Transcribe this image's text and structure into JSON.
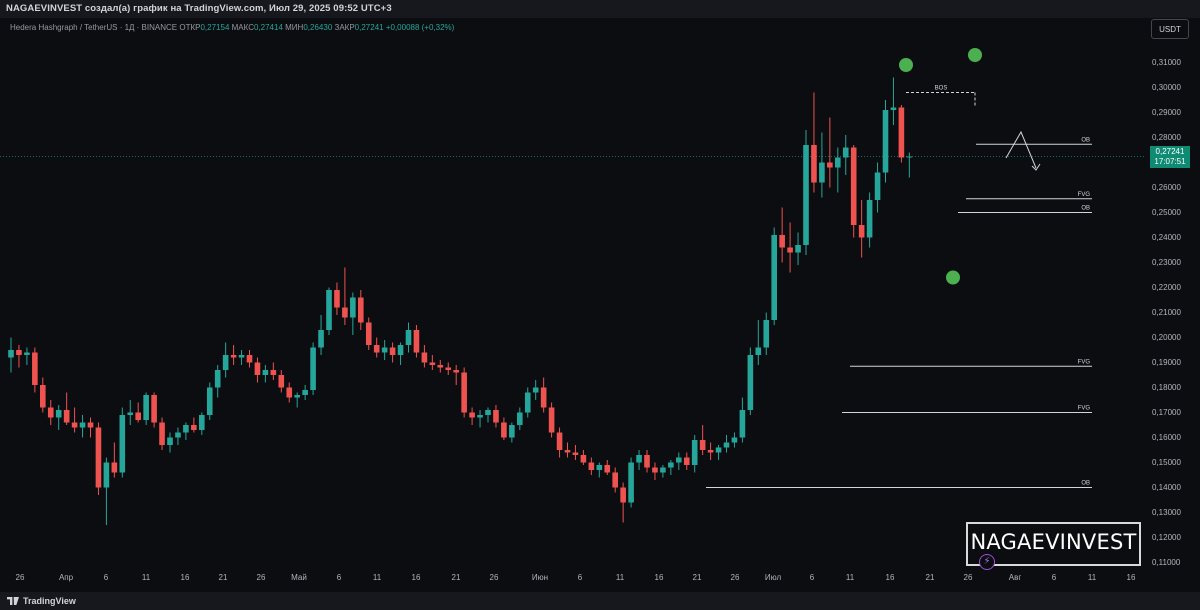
{
  "header": {
    "attribution": "NAGAEVINVEST создал(а) график на TradingView.com, Июл 29, 2025 09:52 UTC+3"
  },
  "symbol": {
    "name": "Hedera Hashgraph / TetherUS · 1Д · BINANCE",
    "open_label": "ОТКР",
    "open": "0,27154",
    "high_label": "МАКС",
    "high": "0,27414",
    "low_label": "МИН",
    "low": "0,26430",
    "close_label": "ЗАКР",
    "close": "0,27241",
    "change": "+0,00088 (+0,32%)"
  },
  "currency_button": "USDT",
  "current_price": {
    "value": "0,27241",
    "countdown": "17:07:51"
  },
  "footer": {
    "logo_text": "TradingView"
  },
  "brand": {
    "text": "NAGAEVINVEST",
    "badge_icon": "lightning-icon"
  },
  "colors": {
    "up": "#26a69a",
    "down": "#ef5350",
    "background": "#0c0d10",
    "marker": "#4caf50",
    "annotation": "#d1d4dc"
  },
  "chart_data": {
    "type": "candlestick",
    "title": "Hedera Hashgraph / TetherUS · 1Д · BINANCE",
    "price_ticks": [
      "0,31000",
      "0,30000",
      "0,29000",
      "0,28000",
      "0,26000",
      "0,25000",
      "0,24000",
      "0,23000",
      "0,22000",
      "0,21000",
      "0,20000",
      "0,19000",
      "0,18000",
      "0,17000",
      "0,16000",
      "0,15000",
      "0,14000",
      "0,13000",
      "0,12000",
      "0,11000"
    ],
    "date_ticks": [
      "26",
      "Апр",
      "6",
      "11",
      "16",
      "21",
      "26",
      "Май",
      "6",
      "11",
      "16",
      "21",
      "26",
      "Июн",
      "6",
      "11",
      "16",
      "21",
      "26",
      "Июл",
      "6",
      "11",
      "16",
      "21",
      "26",
      "Авг",
      "6",
      "11",
      "16"
    ],
    "ylim": [
      0.105,
      0.32
    ],
    "grid": false,
    "last_price": 0.27241,
    "candles": [
      {
        "o": 0.192,
        "h": 0.2,
        "l": 0.186,
        "c": 0.195
      },
      {
        "o": 0.195,
        "h": 0.197,
        "l": 0.188,
        "c": 0.193
      },
      {
        "o": 0.193,
        "h": 0.196,
        "l": 0.189,
        "c": 0.194
      },
      {
        "o": 0.194,
        "h": 0.196,
        "l": 0.178,
        "c": 0.181
      },
      {
        "o": 0.181,
        "h": 0.184,
        "l": 0.17,
        "c": 0.172
      },
      {
        "o": 0.172,
        "h": 0.175,
        "l": 0.165,
        "c": 0.168
      },
      {
        "o": 0.168,
        "h": 0.173,
        "l": 0.163,
        "c": 0.171
      },
      {
        "o": 0.171,
        "h": 0.178,
        "l": 0.165,
        "c": 0.166
      },
      {
        "o": 0.166,
        "h": 0.172,
        "l": 0.162,
        "c": 0.164
      },
      {
        "o": 0.164,
        "h": 0.169,
        "l": 0.16,
        "c": 0.166
      },
      {
        "o": 0.166,
        "h": 0.168,
        "l": 0.16,
        "c": 0.164
      },
      {
        "o": 0.164,
        "h": 0.166,
        "l": 0.137,
        "c": 0.14
      },
      {
        "o": 0.14,
        "h": 0.152,
        "l": 0.125,
        "c": 0.15
      },
      {
        "o": 0.15,
        "h": 0.158,
        "l": 0.144,
        "c": 0.146
      },
      {
        "o": 0.146,
        "h": 0.172,
        "l": 0.144,
        "c": 0.169
      },
      {
        "o": 0.169,
        "h": 0.175,
        "l": 0.165,
        "c": 0.17
      },
      {
        "o": 0.17,
        "h": 0.174,
        "l": 0.166,
        "c": 0.167
      },
      {
        "o": 0.167,
        "h": 0.178,
        "l": 0.165,
        "c": 0.177
      },
      {
        "o": 0.177,
        "h": 0.178,
        "l": 0.164,
        "c": 0.166
      },
      {
        "o": 0.166,
        "h": 0.168,
        "l": 0.155,
        "c": 0.157
      },
      {
        "o": 0.157,
        "h": 0.162,
        "l": 0.154,
        "c": 0.16
      },
      {
        "o": 0.16,
        "h": 0.164,
        "l": 0.157,
        "c": 0.162
      },
      {
        "o": 0.162,
        "h": 0.166,
        "l": 0.159,
        "c": 0.165
      },
      {
        "o": 0.165,
        "h": 0.168,
        "l": 0.162,
        "c": 0.163
      },
      {
        "o": 0.163,
        "h": 0.17,
        "l": 0.161,
        "c": 0.169
      },
      {
        "o": 0.169,
        "h": 0.182,
        "l": 0.167,
        "c": 0.18
      },
      {
        "o": 0.18,
        "h": 0.189,
        "l": 0.176,
        "c": 0.187
      },
      {
        "o": 0.187,
        "h": 0.198,
        "l": 0.184,
        "c": 0.193
      },
      {
        "o": 0.193,
        "h": 0.197,
        "l": 0.189,
        "c": 0.192
      },
      {
        "o": 0.192,
        "h": 0.195,
        "l": 0.189,
        "c": 0.193
      },
      {
        "o": 0.193,
        "h": 0.195,
        "l": 0.188,
        "c": 0.19
      },
      {
        "o": 0.19,
        "h": 0.192,
        "l": 0.182,
        "c": 0.185
      },
      {
        "o": 0.185,
        "h": 0.189,
        "l": 0.182,
        "c": 0.187
      },
      {
        "o": 0.187,
        "h": 0.19,
        "l": 0.183,
        "c": 0.185
      },
      {
        "o": 0.185,
        "h": 0.187,
        "l": 0.178,
        "c": 0.18
      },
      {
        "o": 0.18,
        "h": 0.182,
        "l": 0.174,
        "c": 0.176
      },
      {
        "o": 0.176,
        "h": 0.178,
        "l": 0.172,
        "c": 0.177
      },
      {
        "o": 0.177,
        "h": 0.181,
        "l": 0.175,
        "c": 0.179
      },
      {
        "o": 0.179,
        "h": 0.198,
        "l": 0.177,
        "c": 0.196
      },
      {
        "o": 0.196,
        "h": 0.209,
        "l": 0.193,
        "c": 0.203
      },
      {
        "o": 0.203,
        "h": 0.22,
        "l": 0.201,
        "c": 0.219
      },
      {
        "o": 0.219,
        "h": 0.222,
        "l": 0.209,
        "c": 0.212
      },
      {
        "o": 0.212,
        "h": 0.228,
        "l": 0.205,
        "c": 0.208
      },
      {
        "o": 0.208,
        "h": 0.218,
        "l": 0.201,
        "c": 0.216
      },
      {
        "o": 0.216,
        "h": 0.219,
        "l": 0.203,
        "c": 0.206
      },
      {
        "o": 0.206,
        "h": 0.208,
        "l": 0.195,
        "c": 0.197
      },
      {
        "o": 0.197,
        "h": 0.2,
        "l": 0.192,
        "c": 0.194
      },
      {
        "o": 0.194,
        "h": 0.199,
        "l": 0.191,
        "c": 0.196
      },
      {
        "o": 0.196,
        "h": 0.198,
        "l": 0.19,
        "c": 0.193
      },
      {
        "o": 0.193,
        "h": 0.198,
        "l": 0.189,
        "c": 0.197
      },
      {
        "o": 0.197,
        "h": 0.206,
        "l": 0.194,
        "c": 0.203
      },
      {
        "o": 0.203,
        "h": 0.205,
        "l": 0.192,
        "c": 0.194
      },
      {
        "o": 0.194,
        "h": 0.197,
        "l": 0.188,
        "c": 0.19
      },
      {
        "o": 0.19,
        "h": 0.193,
        "l": 0.187,
        "c": 0.189
      },
      {
        "o": 0.189,
        "h": 0.191,
        "l": 0.186,
        "c": 0.188
      },
      {
        "o": 0.188,
        "h": 0.19,
        "l": 0.185,
        "c": 0.187
      },
      {
        "o": 0.187,
        "h": 0.189,
        "l": 0.181,
        "c": 0.186
      },
      {
        "o": 0.186,
        "h": 0.188,
        "l": 0.168,
        "c": 0.17
      },
      {
        "o": 0.17,
        "h": 0.172,
        "l": 0.165,
        "c": 0.168
      },
      {
        "o": 0.168,
        "h": 0.171,
        "l": 0.164,
        "c": 0.169
      },
      {
        "o": 0.169,
        "h": 0.172,
        "l": 0.166,
        "c": 0.171
      },
      {
        "o": 0.171,
        "h": 0.173,
        "l": 0.164,
        "c": 0.166
      },
      {
        "o": 0.166,
        "h": 0.168,
        "l": 0.159,
        "c": 0.16
      },
      {
        "o": 0.16,
        "h": 0.166,
        "l": 0.158,
        "c": 0.165
      },
      {
        "o": 0.165,
        "h": 0.172,
        "l": 0.163,
        "c": 0.17
      },
      {
        "o": 0.17,
        "h": 0.18,
        "l": 0.168,
        "c": 0.178
      },
      {
        "o": 0.178,
        "h": 0.183,
        "l": 0.175,
        "c": 0.18
      },
      {
        "o": 0.18,
        "h": 0.184,
        "l": 0.17,
        "c": 0.172
      },
      {
        "o": 0.172,
        "h": 0.174,
        "l": 0.16,
        "c": 0.162
      },
      {
        "o": 0.162,
        "h": 0.164,
        "l": 0.152,
        "c": 0.155
      },
      {
        "o": 0.155,
        "h": 0.158,
        "l": 0.152,
        "c": 0.154
      },
      {
        "o": 0.154,
        "h": 0.157,
        "l": 0.151,
        "c": 0.153
      },
      {
        "o": 0.153,
        "h": 0.155,
        "l": 0.149,
        "c": 0.15
      },
      {
        "o": 0.15,
        "h": 0.152,
        "l": 0.145,
        "c": 0.147
      },
      {
        "o": 0.147,
        "h": 0.15,
        "l": 0.144,
        "c": 0.149
      },
      {
        "o": 0.149,
        "h": 0.151,
        "l": 0.145,
        "c": 0.146
      },
      {
        "o": 0.146,
        "h": 0.148,
        "l": 0.138,
        "c": 0.14
      },
      {
        "o": 0.14,
        "h": 0.142,
        "l": 0.126,
        "c": 0.134
      },
      {
        "o": 0.134,
        "h": 0.152,
        "l": 0.132,
        "c": 0.15
      },
      {
        "o": 0.15,
        "h": 0.155,
        "l": 0.147,
        "c": 0.153
      },
      {
        "o": 0.153,
        "h": 0.155,
        "l": 0.146,
        "c": 0.148
      },
      {
        "o": 0.148,
        "h": 0.15,
        "l": 0.143,
        "c": 0.146
      },
      {
        "o": 0.146,
        "h": 0.149,
        "l": 0.144,
        "c": 0.148
      },
      {
        "o": 0.148,
        "h": 0.151,
        "l": 0.145,
        "c": 0.15
      },
      {
        "o": 0.15,
        "h": 0.154,
        "l": 0.147,
        "c": 0.152
      },
      {
        "o": 0.152,
        "h": 0.154,
        "l": 0.147,
        "c": 0.149
      },
      {
        "o": 0.149,
        "h": 0.161,
        "l": 0.146,
        "c": 0.159
      },
      {
        "o": 0.159,
        "h": 0.165,
        "l": 0.153,
        "c": 0.155
      },
      {
        "o": 0.155,
        "h": 0.158,
        "l": 0.151,
        "c": 0.154
      },
      {
        "o": 0.154,
        "h": 0.157,
        "l": 0.151,
        "c": 0.156
      },
      {
        "o": 0.156,
        "h": 0.161,
        "l": 0.154,
        "c": 0.158
      },
      {
        "o": 0.158,
        "h": 0.162,
        "l": 0.156,
        "c": 0.16
      },
      {
        "o": 0.16,
        "h": 0.176,
        "l": 0.158,
        "c": 0.171
      },
      {
        "o": 0.171,
        "h": 0.196,
        "l": 0.169,
        "c": 0.193
      },
      {
        "o": 0.193,
        "h": 0.207,
        "l": 0.189,
        "c": 0.196
      },
      {
        "o": 0.196,
        "h": 0.21,
        "l": 0.193,
        "c": 0.207
      },
      {
        "o": 0.207,
        "h": 0.244,
        "l": 0.205,
        "c": 0.241
      },
      {
        "o": 0.241,
        "h": 0.252,
        "l": 0.23,
        "c": 0.236
      },
      {
        "o": 0.236,
        "h": 0.246,
        "l": 0.226,
        "c": 0.234
      },
      {
        "o": 0.234,
        "h": 0.242,
        "l": 0.229,
        "c": 0.237
      },
      {
        "o": 0.237,
        "h": 0.283,
        "l": 0.233,
        "c": 0.277
      },
      {
        "o": 0.277,
        "h": 0.298,
        "l": 0.258,
        "c": 0.262
      },
      {
        "o": 0.262,
        "h": 0.282,
        "l": 0.256,
        "c": 0.27
      },
      {
        "o": 0.27,
        "h": 0.288,
        "l": 0.26,
        "c": 0.268
      },
      {
        "o": 0.268,
        "h": 0.276,
        "l": 0.258,
        "c": 0.272
      },
      {
        "o": 0.272,
        "h": 0.281,
        "l": 0.265,
        "c": 0.276
      },
      {
        "o": 0.276,
        "h": 0.277,
        "l": 0.24,
        "c": 0.245
      },
      {
        "o": 0.245,
        "h": 0.255,
        "l": 0.232,
        "c": 0.24
      },
      {
        "o": 0.24,
        "h": 0.258,
        "l": 0.236,
        "c": 0.255
      },
      {
        "o": 0.255,
        "h": 0.27,
        "l": 0.25,
        "c": 0.266
      },
      {
        "o": 0.266,
        "h": 0.295,
        "l": 0.262,
        "c": 0.291
      },
      {
        "o": 0.291,
        "h": 0.304,
        "l": 0.285,
        "c": 0.292
      },
      {
        "o": 0.292,
        "h": 0.293,
        "l": 0.27,
        "c": 0.272
      },
      {
        "o": 0.272,
        "h": 0.274,
        "l": 0.264,
        "c": 0.2724
      }
    ],
    "annotations": {
      "levels": [
        {
          "label": "OB",
          "price": 0.2773
        },
        {
          "label": "FVG",
          "price": 0.2555
        },
        {
          "label": "OB",
          "price": 0.25
        },
        {
          "label": "FVG",
          "price": 0.1885
        },
        {
          "label": "FVG",
          "price": 0.17
        },
        {
          "label": "OB",
          "price": 0.14
        }
      ],
      "bos": {
        "label": "BOS",
        "price": 0.298
      },
      "markers": [
        {
          "name": "swing-high-marker-1",
          "price": 0.309
        },
        {
          "name": "swing-high-marker-2",
          "price": 0.313
        },
        {
          "name": "swing-low-marker",
          "price": 0.224
        }
      ]
    }
  }
}
